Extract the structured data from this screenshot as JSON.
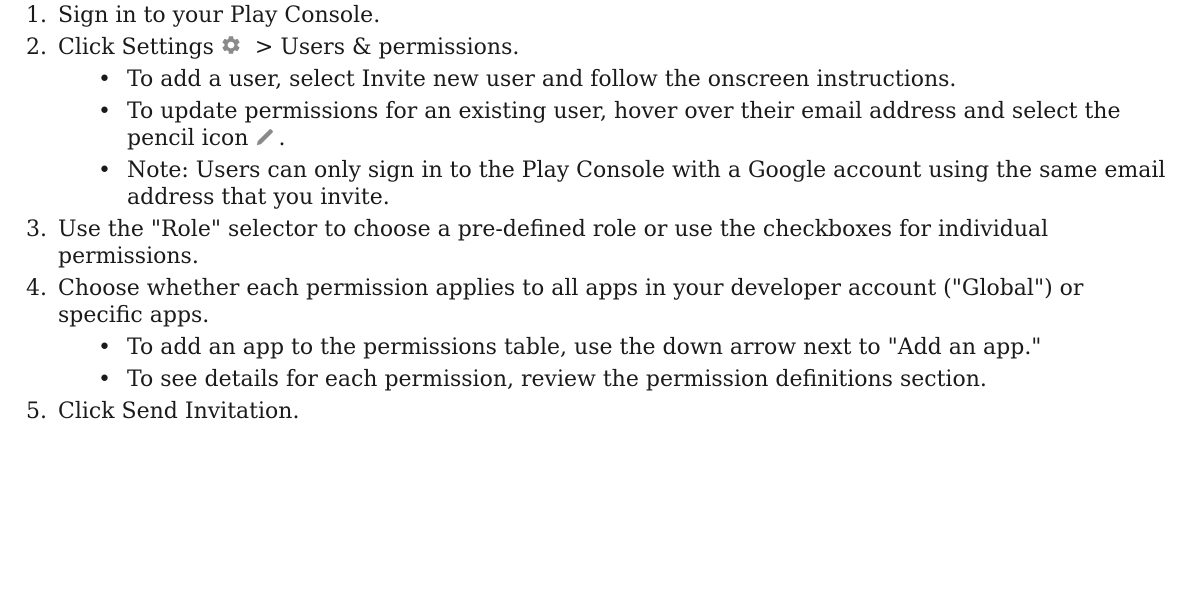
{
  "steps": [
    {
      "num": "1.",
      "text": "Sign in to your Play Console."
    },
    {
      "num": "2.",
      "text_before_icon": "Click Settings",
      "icon": "gear-icon",
      "text_after_icon": " > Users & permissions.",
      "bullets": [
        {
          "text": "To add a user, select Invite new user and follow the onscreen instructions."
        },
        {
          "text_before_icon": "To update permissions for an existing user, hover over their email address and select the pencil icon",
          "icon": "pencil-icon",
          "text_after_icon": "."
        },
        {
          "text": "Note: Users can only sign in to the Play Console with a Google account using the same email address that you invite."
        }
      ]
    },
    {
      "num": "3.",
      "text": "Use the \"Role\" selector to choose a pre-defined role or use the checkboxes for individual permissions."
    },
    {
      "num": "4.",
      "text": "Choose whether each permission applies to all apps in your developer account (\"Global\") or specific apps.",
      "bullets": [
        {
          "text": "To add an app to the permissions table, use the down arrow next to \"Add an app.\""
        },
        {
          "text": "To see details for each permission, review the permission definitions section."
        }
      ]
    },
    {
      "num": "5.",
      "text": "Click Send Invitation."
    }
  ],
  "bullet_char": "•",
  "colors": {
    "text": "#1a1a1a",
    "icon": "#8a8a8a"
  }
}
